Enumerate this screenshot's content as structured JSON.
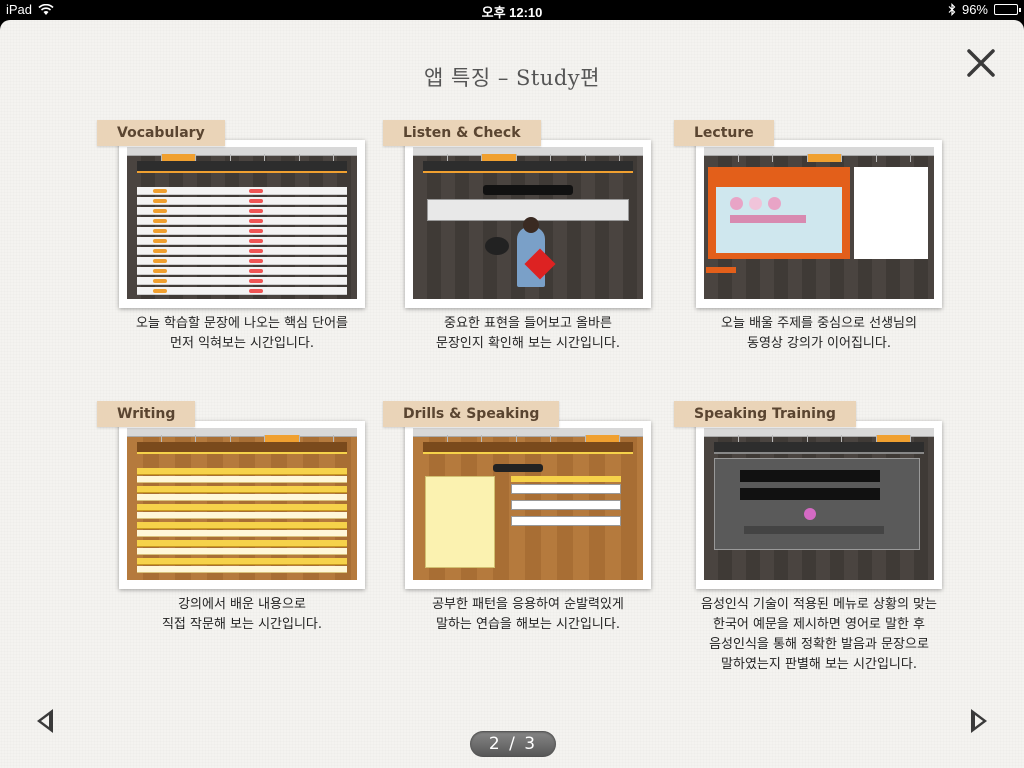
{
  "status_bar": {
    "device": "iPad",
    "time": "오후 12:10",
    "battery": "96%",
    "battery_level": 0.96
  },
  "page": {
    "title": "앱 특징 – Study편"
  },
  "cards": [
    {
      "tag": "Vocabulary",
      "desc_line1": "오늘 학습할 문장에 나오는 핵심 단어를",
      "desc_line2": "먼저 익혀보는 시간입니다."
    },
    {
      "tag": "Listen & Check",
      "desc_line1": "중요한 표현을 들어보고 올바른",
      "desc_line2": "문장인지 확인해 보는 시간입니다."
    },
    {
      "tag": "Lecture",
      "desc_line1": "오늘 배울 주제를 중심으로 선생님의",
      "desc_line2": "동영상 강의가 이어집니다."
    },
    {
      "tag": "Writing",
      "desc_line1": "강의에서 배운 내용으로",
      "desc_line2": "직접 작문해 보는 시간입니다."
    },
    {
      "tag": "Drills & Speaking",
      "desc_line1": "공부한 패턴을 응용하여 순발력있게",
      "desc_line2": "말하는 연습을 해보는 시간입니다."
    },
    {
      "tag": "Speaking Training",
      "desc_line1": "음성인식 기술이 적용된 메뉴로 상황의 맞는",
      "desc_line2": "한국어 예문을 제시하면 영어로 말한 후",
      "desc_line3": "음성인식을 통해 정확한 발음과 문장으로",
      "desc_line4": "말하였는지 판별해 보는 시간입니다."
    }
  ],
  "pager": {
    "label": "2 / 3"
  },
  "icons": {
    "close": "close-icon",
    "prev": "prev-arrow-icon",
    "next": "next-arrow-icon",
    "wifi": "wifi-icon",
    "bluetooth": "bluetooth-icon"
  },
  "colors": {
    "tag_bg": "#ead4b8",
    "accent": "#f0a030",
    "panel_bg": "#f4f3f0"
  }
}
